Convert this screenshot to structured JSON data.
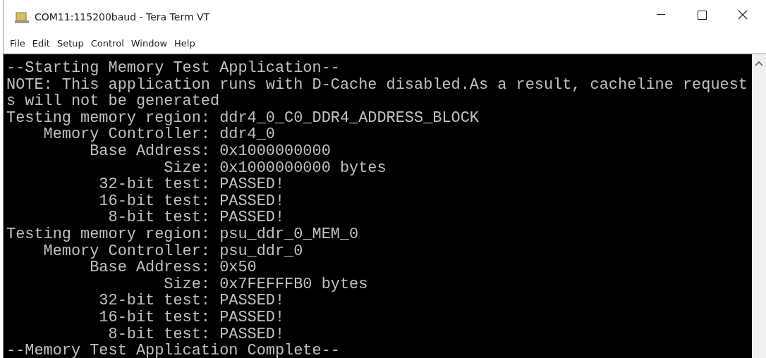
{
  "window": {
    "title": "COM11:115200baud - Tera Term VT"
  },
  "menu": [
    "File",
    "Edit",
    "Setup",
    "Control",
    "Window",
    "Help"
  ],
  "terminal": {
    "lines": [
      "--Starting Memory Test Application--",
      "NOTE: This application runs with D-Cache disabled.As a result, cacheline request",
      "s will not be generated",
      "Testing memory region: ddr4_0_C0_DDR4_ADDRESS_BLOCK",
      "    Memory Controller: ddr4_0",
      "         Base Address: 0x1000000000",
      "                 Size: 0x1000000000 bytes",
      "          32-bit test: PASSED!",
      "          16-bit test: PASSED!",
      "           8-bit test: PASSED!",
      "Testing memory region: psu_ddr_0_MEM_0",
      "    Memory Controller: psu_ddr_0",
      "         Base Address: 0x50",
      "                 Size: 0x7FEFFFB0 bytes",
      "          32-bit test: PASSED!",
      "          16-bit test: PASSED!",
      "           8-bit test: PASSED!",
      "--Memory Test Application Complete--"
    ]
  }
}
